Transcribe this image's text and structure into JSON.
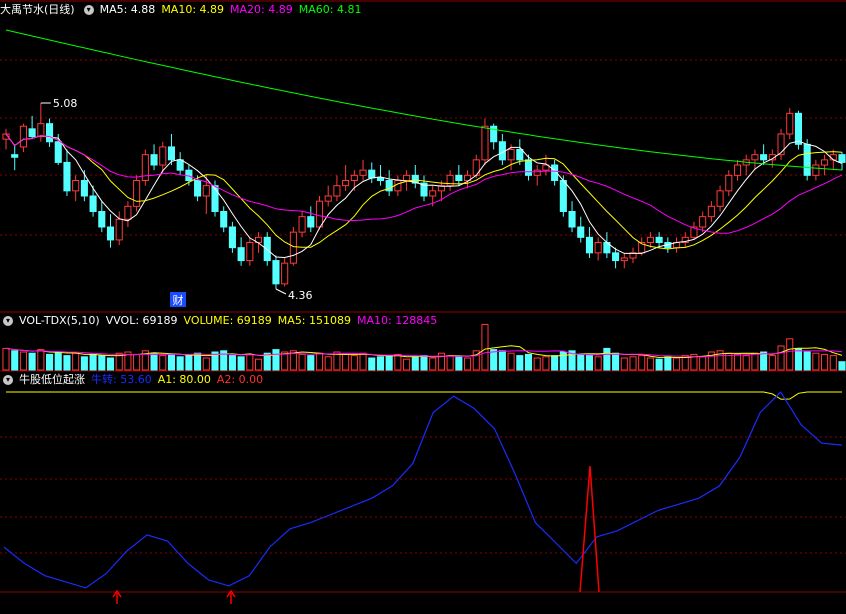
{
  "colors": {
    "up": "#ff3a3a",
    "down": "#54ffff",
    "ma5": "#ffffff",
    "ma10": "#ffff00",
    "ma20": "#ff00ff",
    "ma60": "#00ff00",
    "blue": "#1a2cff",
    "red": "#ff0000",
    "grid": "#8b0000",
    "text": "#c8c8c8"
  },
  "main_legend": {
    "title": "大禹节水(日线)",
    "ma5": "MA5: 4.88",
    "ma10": "MA10: 4.89",
    "ma20": "MA20: 4.89",
    "ma60": "MA60: 4.81"
  },
  "vol_legend": {
    "title": "VOL-TDX(5,10)",
    "vvol": "VVOL: 69189",
    "volume": "VOLUME: 69189",
    "ma5": "MA5: 151089",
    "ma10": "MA10: 128845"
  },
  "ind_legend": {
    "title": "牛股低位起涨",
    "niu": "牛转: 53.60",
    "a1": "A1: 80.00",
    "a2": "A2: 0.00"
  },
  "annotations": {
    "high_label": "5.08",
    "low_label": "4.36",
    "cai": "财"
  },
  "chart_data": [
    {
      "type": "candlestick",
      "title": "大禹节水(日线)",
      "price_range": [
        4.36,
        5.08
      ],
      "series_names": [
        "MA5",
        "MA10",
        "MA20",
        "MA60"
      ],
      "ohlc": [
        [
          4.94,
          4.98,
          4.9,
          4.96
        ],
        [
          4.88,
          4.92,
          4.82,
          4.87
        ],
        [
          4.91,
          5.0,
          4.89,
          4.99
        ],
        [
          4.98,
          5.03,
          4.94,
          4.95
        ],
        [
          4.95,
          5.08,
          4.93,
          5.0
        ],
        [
          5.0,
          5.02,
          4.91,
          4.93
        ],
        [
          4.93,
          4.96,
          4.84,
          4.85
        ],
        [
          4.85,
          4.9,
          4.72,
          4.74
        ],
        [
          4.74,
          4.8,
          4.7,
          4.78
        ],
        [
          4.78,
          4.82,
          4.7,
          4.72
        ],
        [
          4.72,
          4.76,
          4.64,
          4.66
        ],
        [
          4.66,
          4.7,
          4.58,
          4.6
        ],
        [
          4.6,
          4.65,
          4.52,
          4.55
        ],
        [
          4.55,
          4.66,
          4.53,
          4.63
        ],
        [
          4.63,
          4.7,
          4.6,
          4.68
        ],
        [
          4.68,
          4.8,
          4.66,
          4.78
        ],
        [
          4.78,
          4.9,
          4.76,
          4.88
        ],
        [
          4.88,
          4.92,
          4.82,
          4.84
        ],
        [
          4.84,
          4.93,
          4.81,
          4.91
        ],
        [
          4.91,
          4.96,
          4.84,
          4.86
        ],
        [
          4.86,
          4.89,
          4.8,
          4.82
        ],
        [
          4.82,
          4.84,
          4.76,
          4.78
        ],
        [
          4.78,
          4.8,
          4.7,
          4.72
        ],
        [
          4.72,
          4.8,
          4.65,
          4.76
        ],
        [
          4.76,
          4.78,
          4.64,
          4.66
        ],
        [
          4.66,
          4.68,
          4.58,
          4.6
        ],
        [
          4.6,
          4.62,
          4.5,
          4.52
        ],
        [
          4.52,
          4.56,
          4.45,
          4.47
        ],
        [
          4.47,
          4.56,
          4.45,
          4.54
        ],
        [
          4.54,
          4.58,
          4.5,
          4.56
        ],
        [
          4.56,
          4.58,
          4.45,
          4.47
        ],
        [
          4.47,
          4.49,
          4.36,
          4.38
        ],
        [
          4.38,
          4.48,
          4.37,
          4.46
        ],
        [
          4.46,
          4.6,
          4.45,
          4.58
        ],
        [
          4.58,
          4.66,
          4.56,
          4.64
        ],
        [
          4.64,
          4.68,
          4.58,
          4.6
        ],
        [
          4.6,
          4.72,
          4.59,
          4.7
        ],
        [
          4.7,
          4.76,
          4.68,
          4.72
        ],
        [
          4.72,
          4.8,
          4.7,
          4.76
        ],
        [
          4.76,
          4.84,
          4.74,
          4.78
        ],
        [
          4.78,
          4.82,
          4.74,
          4.8
        ],
        [
          4.8,
          4.86,
          4.78,
          4.82
        ],
        [
          4.82,
          4.85,
          4.77,
          4.79
        ],
        [
          4.79,
          4.84,
          4.76,
          4.78
        ],
        [
          4.78,
          4.82,
          4.72,
          4.74
        ],
        [
          4.74,
          4.8,
          4.72,
          4.78
        ],
        [
          4.78,
          4.82,
          4.74,
          4.8
        ],
        [
          4.8,
          4.84,
          4.75,
          4.77
        ],
        [
          4.77,
          4.8,
          4.7,
          4.72
        ],
        [
          4.72,
          4.76,
          4.68,
          4.74
        ],
        [
          4.74,
          4.78,
          4.7,
          4.76
        ],
        [
          4.76,
          4.82,
          4.74,
          4.8
        ],
        [
          4.8,
          4.84,
          4.76,
          4.78
        ],
        [
          4.78,
          4.82,
          4.75,
          4.8
        ],
        [
          4.8,
          4.88,
          4.79,
          4.86
        ],
        [
          4.86,
          5.02,
          4.84,
          4.99
        ],
        [
          4.99,
          5.0,
          4.9,
          4.93
        ],
        [
          4.93,
          4.96,
          4.84,
          4.86
        ],
        [
          4.86,
          4.92,
          4.82,
          4.9
        ],
        [
          4.9,
          4.94,
          4.84,
          4.86
        ],
        [
          4.86,
          4.88,
          4.78,
          4.8
        ],
        [
          4.8,
          4.84,
          4.76,
          4.82
        ],
        [
          4.82,
          4.88,
          4.8,
          4.84
        ],
        [
          4.84,
          4.86,
          4.76,
          4.78
        ],
        [
          4.78,
          4.8,
          4.64,
          4.66
        ],
        [
          4.66,
          4.7,
          4.58,
          4.6
        ],
        [
          4.6,
          4.64,
          4.54,
          4.56
        ],
        [
          4.56,
          4.6,
          4.48,
          4.5
        ],
        [
          4.5,
          4.56,
          4.47,
          4.54
        ],
        [
          4.54,
          4.58,
          4.48,
          4.5
        ],
        [
          4.5,
          4.52,
          4.44,
          4.47
        ],
        [
          4.47,
          4.5,
          4.44,
          4.48
        ],
        [
          4.48,
          4.52,
          4.46,
          4.5
        ],
        [
          4.5,
          4.56,
          4.49,
          4.54
        ],
        [
          4.54,
          4.58,
          4.52,
          4.56
        ],
        [
          4.56,
          4.58,
          4.52,
          4.54
        ],
        [
          4.54,
          4.56,
          4.5,
          4.52
        ],
        [
          4.52,
          4.56,
          4.5,
          4.54
        ],
        [
          4.54,
          4.58,
          4.52,
          4.56
        ],
        [
          4.56,
          4.62,
          4.55,
          4.6
        ],
        [
          4.6,
          4.66,
          4.58,
          4.64
        ],
        [
          4.64,
          4.7,
          4.62,
          4.68
        ],
        [
          4.68,
          4.76,
          4.66,
          4.74
        ],
        [
          4.74,
          4.82,
          4.72,
          4.8
        ],
        [
          4.8,
          4.86,
          4.78,
          4.84
        ],
        [
          4.84,
          4.88,
          4.8,
          4.86
        ],
        [
          4.86,
          4.9,
          4.82,
          4.88
        ],
        [
          4.88,
          4.92,
          4.84,
          4.86
        ],
        [
          4.86,
          4.9,
          4.83,
          4.88
        ],
        [
          4.88,
          4.98,
          4.86,
          4.96
        ],
        [
          4.96,
          5.06,
          4.94,
          5.04
        ],
        [
          5.04,
          5.05,
          4.9,
          4.92
        ],
        [
          4.92,
          4.94,
          4.78,
          4.8
        ],
        [
          4.8,
          4.86,
          4.78,
          4.84
        ],
        [
          4.84,
          4.88,
          4.8,
          4.86
        ],
        [
          4.86,
          4.9,
          4.82,
          4.88
        ],
        [
          4.88,
          4.89,
          4.82,
          4.85
        ]
      ]
    },
    {
      "type": "bar",
      "title": "VOL-TDX(5,10)",
      "series_names": [
        "VOLUME",
        "MA5",
        "MA10"
      ],
      "values": [
        180000,
        160000,
        150000,
        140000,
        170000,
        130000,
        150000,
        120000,
        140000,
        110000,
        130000,
        120000,
        100000,
        140000,
        150000,
        130000,
        160000,
        140000,
        120000,
        130000,
        110000,
        120000,
        140000,
        100000,
        150000,
        160000,
        120000,
        110000,
        130000,
        90000,
        140000,
        170000,
        150000,
        160000,
        130000,
        120000,
        140000,
        110000,
        150000,
        130000,
        120000,
        140000,
        100000,
        110000,
        120000,
        130000,
        90000,
        110000,
        120000,
        100000,
        140000,
        120000,
        110000,
        100000,
        160000,
        380000,
        170000,
        160000,
        140000,
        120000,
        130000,
        100000,
        110000,
        120000,
        150000,
        160000,
        130000,
        120000,
        110000,
        180000,
        140000,
        100000,
        110000,
        120000,
        100000,
        90000,
        110000,
        100000,
        120000,
        130000,
        110000,
        150000,
        160000,
        140000,
        130000,
        120000,
        140000,
        150000,
        120000,
        200000,
        260000,
        180000,
        150000,
        140000,
        130000,
        120000,
        69189
      ]
    },
    {
      "type": "line",
      "title": "牛股低位起涨",
      "series_names": [
        "牛转",
        "A1",
        "A2"
      ],
      "A1": 80.0,
      "A2": 0.0
    }
  ]
}
